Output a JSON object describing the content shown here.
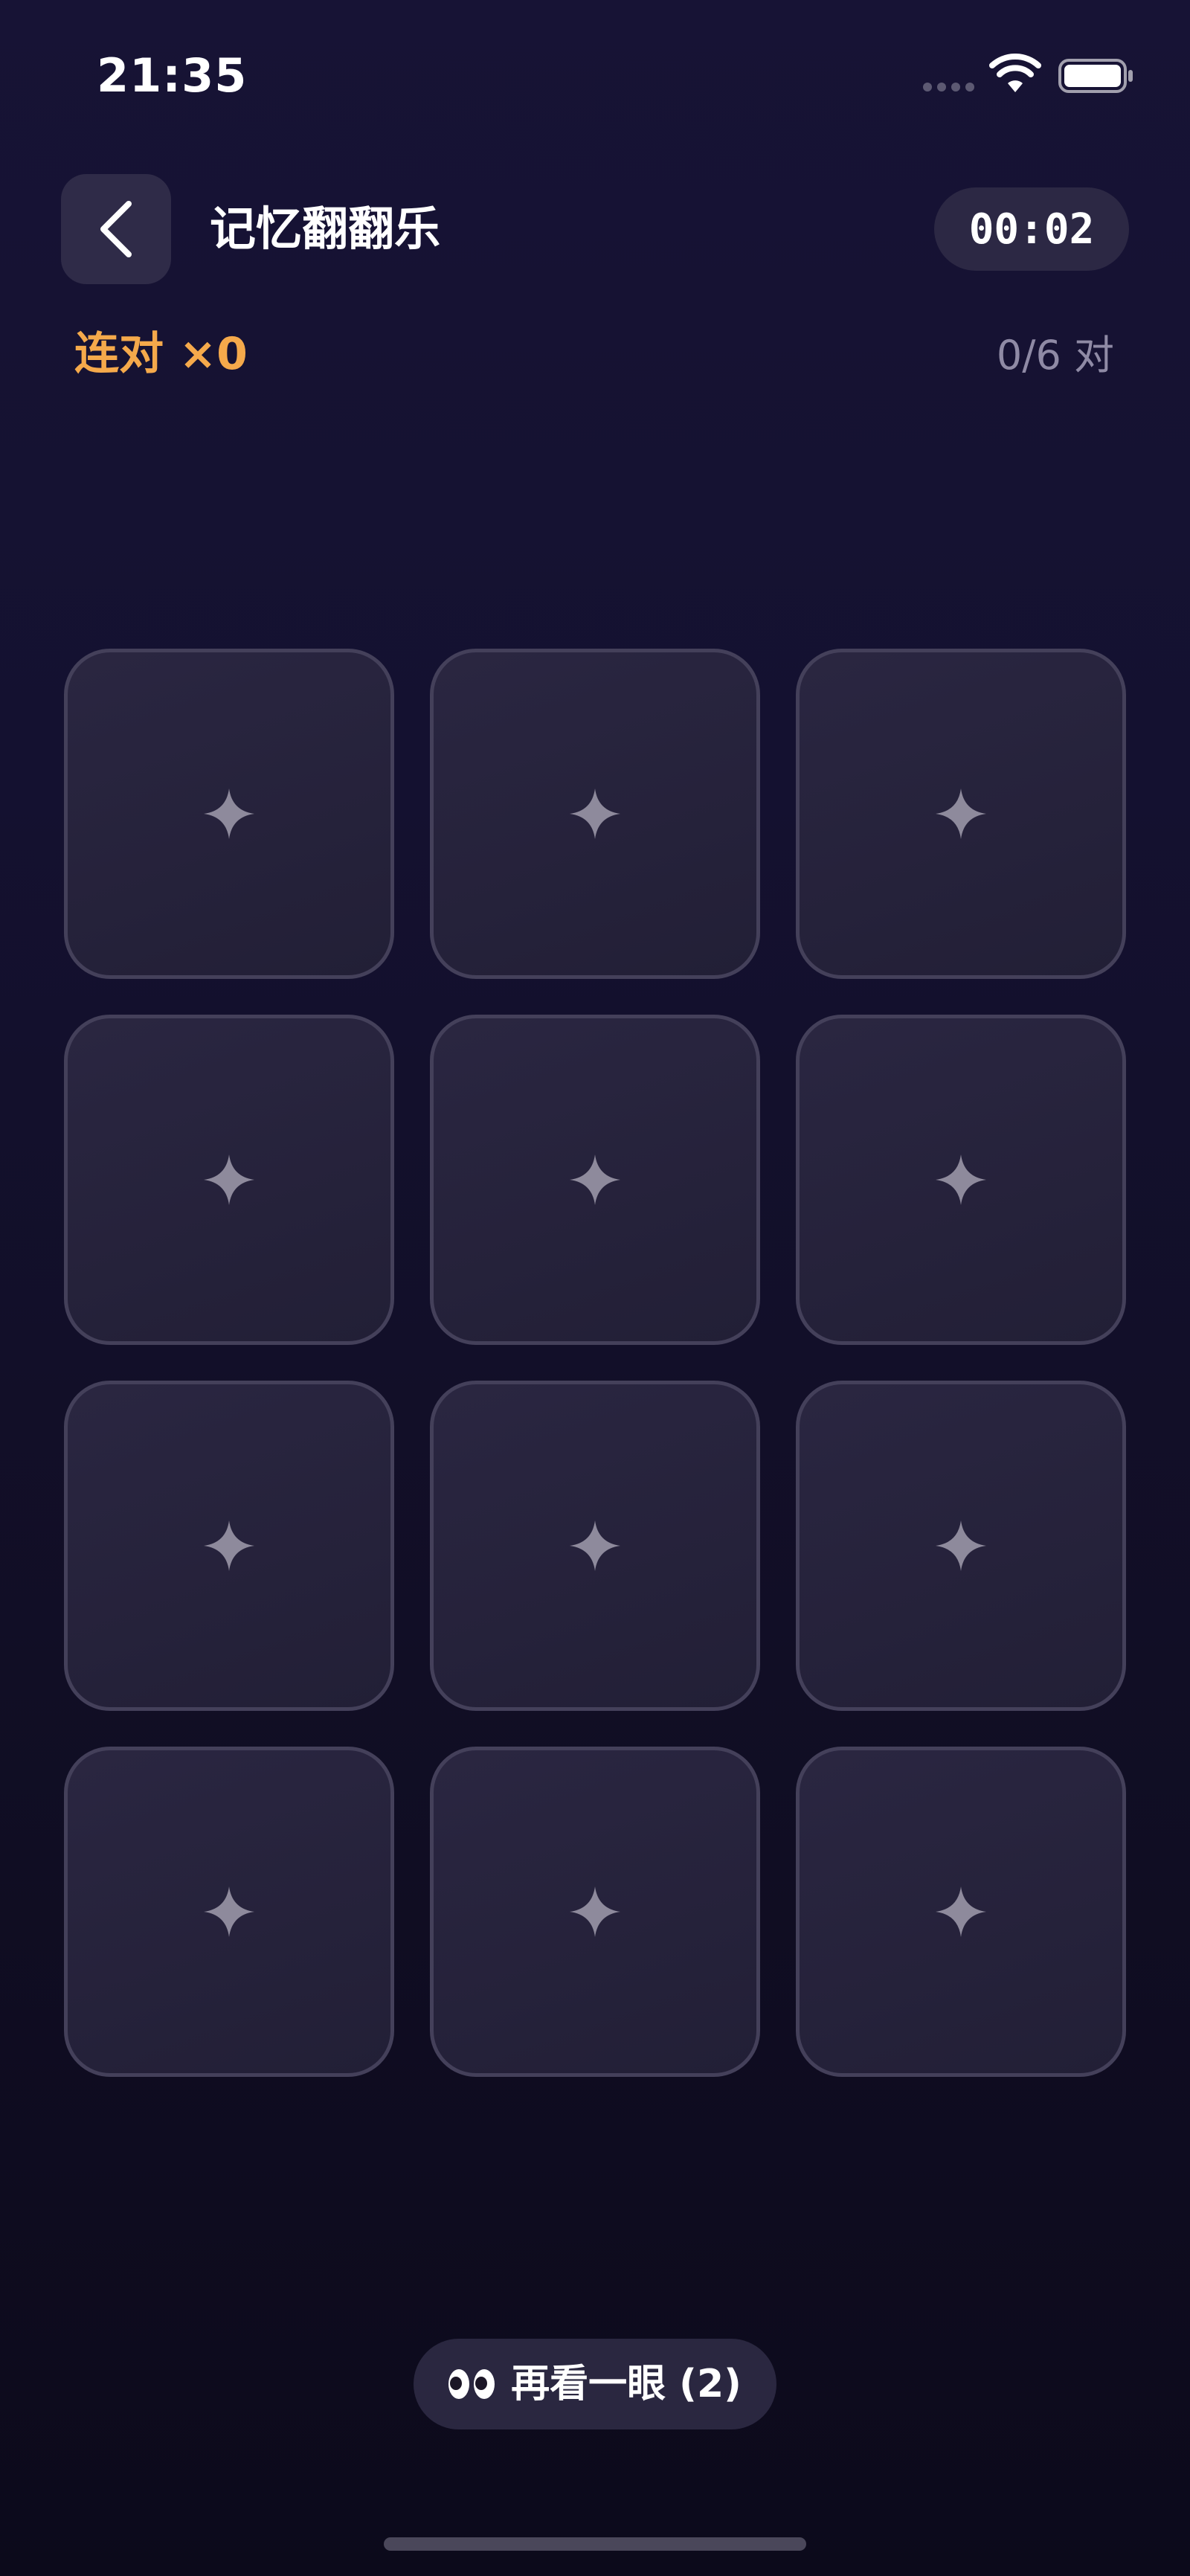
{
  "status_bar": {
    "time": "21:35"
  },
  "header": {
    "title": "记忆翻翻乐",
    "timer": "00:02"
  },
  "stats": {
    "combo": "连对 ×0",
    "pairs": "0/6 对"
  },
  "grid": {
    "rows": 4,
    "columns": 3,
    "card_back_icon": "sparkle-icon"
  },
  "peek": {
    "icon": "eyes-icon",
    "label": "再看一眼 (2)"
  },
  "colors": {
    "accent": "#f5a94b",
    "card_border": "#44405a",
    "card_icon": "#8e8a9c"
  }
}
